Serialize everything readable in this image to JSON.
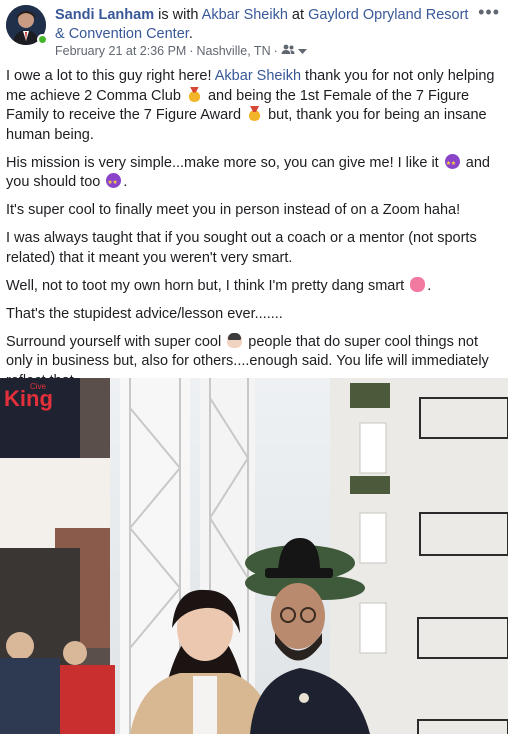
{
  "header": {
    "author": "Sandi Lanham",
    "with_text": " is with ",
    "tagged": "Akbar Sheikh",
    "at_text": " at ",
    "place": "Gaylord Opryland Resort & Convention Center",
    "place_end": ".",
    "timestamp": "February 21 at 2:36 PM",
    "separator": " · ",
    "location": "Nashville, TN",
    "separator2": " · "
  },
  "icons": {
    "more": "more-options-icon",
    "audience": "friends-audience-icon",
    "dropdown": "chevron-down-icon"
  },
  "post": {
    "p1_a": "I owe a lot to this guy right here! ",
    "p1_mention": "Akbar Sheikh",
    "p1_b": " thank you for not only helping me achieve 2 Comma Club ",
    "p1_c": " and being the 1st Female of the 7 Figure Family to receive the 7 Figure Award ",
    "p1_d": " but, thank you for being an insane human being.",
    "p2_a": "His mission is very simple...make more so, you can give me! I like it ",
    "p2_b": " and you should too ",
    "p2_c": ".",
    "p3": "It's super cool to finally meet you in person instead of on a Zoom haha!",
    "p4": "I was always taught that if you sought out a coach or a mentor (not sports related) that it meant you weren't very smart.",
    "p5_a": "Well, not to toot my own horn but, I think I'm pretty dang smart ",
    "p5_b": ".",
    "p6": "That's the stupidest advice/lesson ever.......",
    "p7_a": "Surround yourself with super cool ",
    "p7_b": " people that do super cool things not only in business but, also for others....enough said. You life will immediately reflect that."
  },
  "photo": {
    "sign_text": "King",
    "sign_small": "Cive"
  },
  "colors": {
    "link": "#385898",
    "meta": "#606770",
    "online": "#42b72a"
  }
}
